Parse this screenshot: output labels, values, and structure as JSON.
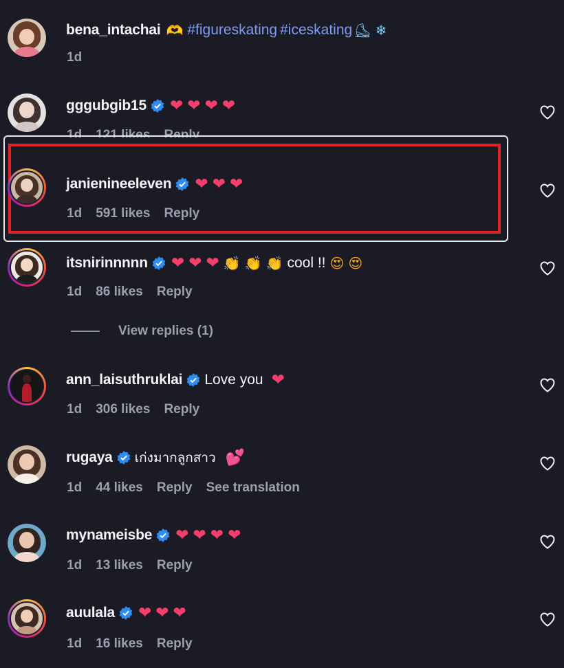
{
  "comments": [
    {
      "username": "bena_intachai",
      "verified": false,
      "emojis_before": [
        "🫶"
      ],
      "hashtags": [
        "#figureskating",
        "#iceskating"
      ],
      "emojis_after": [
        "⛸",
        "❄"
      ],
      "time": "1d",
      "likes": "",
      "reply": "",
      "show_like_button": false
    },
    {
      "username": "gggubgib15",
      "verified": true,
      "text": "",
      "emojis": [
        "❤",
        "❤",
        "❤",
        "❤"
      ],
      "time": "1d",
      "likes": "121 likes",
      "reply": "Reply"
    },
    {
      "username": "janienineeleven",
      "verified": true,
      "text": "",
      "emojis": [
        "❤",
        "❤",
        "❤"
      ],
      "time": "1d",
      "likes": "591 likes",
      "reply": "Reply"
    },
    {
      "username": "itsnirinnnnn",
      "verified": true,
      "emojis": [
        "❤",
        "❤",
        "❤",
        "👏",
        "👏",
        "👏"
      ],
      "text": "cool !!",
      "emojis_after": [
        "😍",
        "😍"
      ],
      "time": "1d",
      "likes": "86 likes",
      "reply": "Reply"
    },
    {
      "username": "ann_laisuthruklai",
      "verified": true,
      "text": "Love you",
      "emojis_after": [
        "❤"
      ],
      "time": "1d",
      "likes": "306 likes",
      "reply": "Reply"
    },
    {
      "username": "rugaya",
      "verified": true,
      "text": "เก่งมากลูกสาว",
      "emojis_after": [
        "💕"
      ],
      "time": "1d",
      "likes": "44 likes",
      "reply": "Reply",
      "extra": "See translation"
    },
    {
      "username": "mynameisbe",
      "verified": true,
      "text": "",
      "emojis": [
        "❤",
        "❤",
        "❤",
        "❤"
      ],
      "time": "1d",
      "likes": "13 likes",
      "reply": "Reply"
    },
    {
      "username": "auulala",
      "verified": true,
      "text": "",
      "emojis": [
        "❤",
        "❤",
        "❤"
      ],
      "time": "1d",
      "likes": "16 likes",
      "reply": "Reply"
    }
  ],
  "view_replies": "View replies (1)",
  "colors": {
    "background": "#1a1b25",
    "hashtag": "#7f9cf5",
    "verified": "#2f8cf0",
    "highlight": "#e02426",
    "muted": "#9aa0ad"
  },
  "icons": {
    "verified": "verified-badge-icon",
    "like": "heart-outline-icon"
  }
}
